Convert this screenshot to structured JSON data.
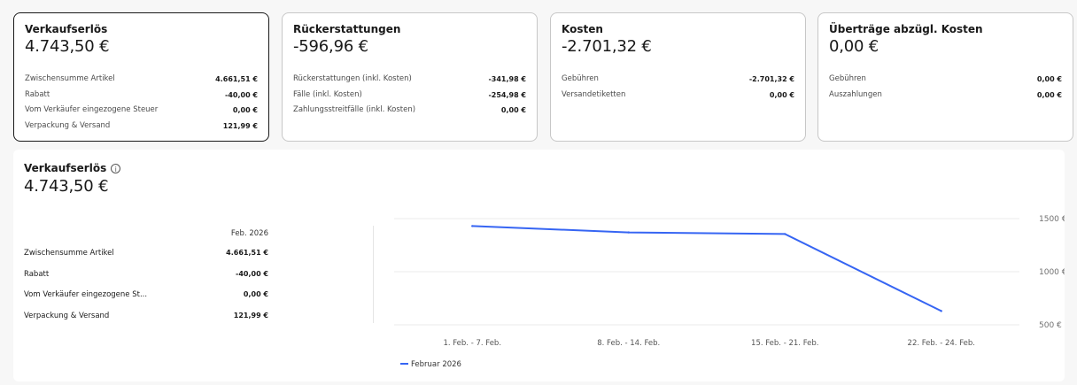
{
  "cards": [
    {
      "title": "Verkaufserlös",
      "value": "4.743,50 €",
      "selected": true,
      "rows": [
        {
          "label": "Zwischensumme Artikel",
          "value": "4.661,51 €"
        },
        {
          "label": "Rabatt",
          "value": "-40,00 €"
        },
        {
          "label": "Vom Verkäufer eingezogene Steuer",
          "value": "0,00 €"
        },
        {
          "label": "Verpackung & Versand",
          "value": "121,99 €"
        }
      ]
    },
    {
      "title": "Rückerstattungen",
      "value": "-596,96 €",
      "selected": false,
      "rows": [
        {
          "label": "Rückerstattungen (inkl. Kosten)",
          "value": "-341,98 €"
        },
        {
          "label": "Fälle (inkl. Kosten)",
          "value": "-254,98 €"
        },
        {
          "label": "Zahlungsstreitfälle (inkl. Kosten)",
          "value": "0,00 €"
        }
      ]
    },
    {
      "title": "Kosten",
      "value": "-2.701,32 €",
      "selected": false,
      "rows": [
        {
          "label": "Gebühren",
          "value": "-2.701,32 €"
        },
        {
          "label": "Versandetiketten",
          "value": "0,00 €"
        }
      ]
    },
    {
      "title": "Überträge abzügl. Kosten",
      "value": "0,00 €",
      "selected": false,
      "rows": [
        {
          "label": "Gebühren",
          "value": "0,00 €"
        },
        {
          "label": "Auszahlungen",
          "value": "0,00 €"
        }
      ]
    }
  ],
  "panel": {
    "title": "Verkaufserlös",
    "value": "4.743,50 €",
    "column_header": "Feb. 2026",
    "rows": [
      {
        "label": "Zwischensumme Artikel",
        "value": "4.661,51 €"
      },
      {
        "label": "Rabatt",
        "value": "-40,00 €"
      },
      {
        "label": "Vom Verkäufer eingezogene St...",
        "value": "0,00 €"
      },
      {
        "label": "Verpackung & Versand",
        "value": "121,99 €"
      }
    ]
  },
  "chart_data": {
    "type": "line",
    "categories": [
      "1. Feb. - 7. Feb.",
      "8. Feb. - 14. Feb.",
      "15. Feb. - 21. Feb.",
      "22. Feb. - 24. Feb."
    ],
    "series": [
      {
        "name": "Februar 2026",
        "color": "#3665f3",
        "values": [
          1430,
          1370,
          1355,
          630
        ]
      }
    ],
    "y_ticks": [
      "1500 €",
      "1000 €",
      "500 €"
    ],
    "y_tick_values": [
      1500,
      1000,
      500
    ],
    "ylim": [
      500,
      1500
    ],
    "grid": true,
    "legend_position": "bottom-left"
  }
}
